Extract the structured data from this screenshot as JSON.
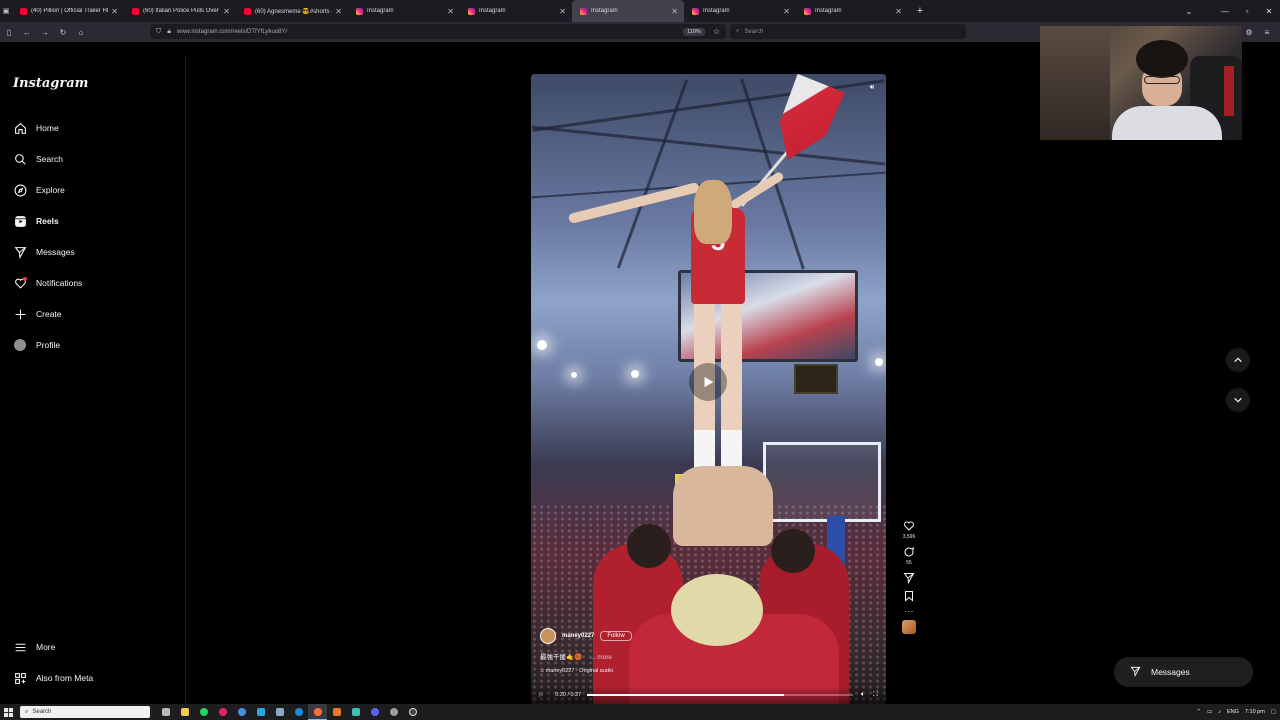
{
  "browser": {
    "tabs": [
      {
        "title": "(40) Pillion | Official Trailer HD |",
        "favicon": "youtube",
        "active": false
      },
      {
        "title": "(60) Italian Police Pulls Over Fe",
        "favicon": "youtube",
        "active": false
      },
      {
        "title": "(60) Agnesmeme 😎#shorts - Yo",
        "favicon": "youtube",
        "active": false
      },
      {
        "title": "Instagram",
        "favicon": "instagram",
        "active": false
      },
      {
        "title": "Instagram",
        "favicon": "instagram",
        "active": false
      },
      {
        "title": "Instagram",
        "favicon": "instagram",
        "active": true
      },
      {
        "title": "Instagram",
        "favicon": "instagram",
        "active": false
      },
      {
        "title": "Instagram",
        "favicon": "instagram",
        "active": false
      }
    ],
    "new_tab_label": "+",
    "url": "www.instagram.com/reels/DTfYfLykuo8Y/",
    "zoom": "110%",
    "search_placeholder": "Search"
  },
  "instagram": {
    "logo": "Instagram",
    "nav": [
      {
        "label": "Home",
        "icon": "home-icon"
      },
      {
        "label": "Search",
        "icon": "search-icon"
      },
      {
        "label": "Explore",
        "icon": "compass-icon"
      },
      {
        "label": "Reels",
        "icon": "reels-icon"
      },
      {
        "label": "Messages",
        "icon": "messenger-icon"
      },
      {
        "label": "Notifications",
        "icon": "heart-icon"
      },
      {
        "label": "Create",
        "icon": "plus-icon"
      },
      {
        "label": "Profile",
        "icon": "avatar-icon"
      }
    ],
    "more_label": "More",
    "meta_label": "Also from Meta",
    "reel": {
      "username": "maney0227",
      "follow_label": "Follow",
      "caption": "最強千援🤙🏀",
      "more_label": "... more",
      "audio": "maney0227 · Original audio",
      "time": "0:20 / 0:27",
      "progress": 0.74,
      "jersey_number": "5"
    },
    "actions": {
      "likes": "3,596",
      "comments": "55"
    },
    "messages_button": "Messages"
  },
  "taskbar": {
    "search_placeholder": "Search",
    "language": "ENG",
    "time": "7:10 pm"
  },
  "colors": {
    "background": "#000000",
    "sidebar_text": "#f5f5f5",
    "tab_active": "#42414d",
    "jersey_red": "#c82a36"
  }
}
